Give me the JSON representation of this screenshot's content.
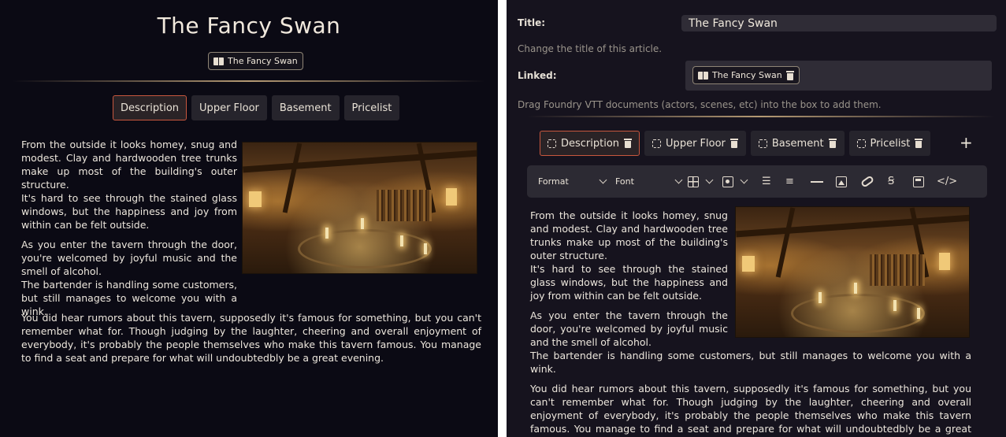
{
  "viewer": {
    "title": "The Fancy Swan",
    "linked_doc": "The Fancy Swan",
    "tabs": [
      {
        "label": "Description",
        "active": true
      },
      {
        "label": "Upper Floor",
        "active": false
      },
      {
        "label": "Basement",
        "active": false
      },
      {
        "label": "Pricelist",
        "active": false
      }
    ],
    "paragraphs": [
      "From the outside it looks homey, snug and modest. Clay and hardwooden tree trunks make up most of the building's outer structure.",
      "It's hard to see through the stained glass windows, but the happiness and joy from within can be felt outside.",
      "As you enter the tavern through the door, you're welcomed by joyful music and the smell of alcohol.",
      "The bartender is handling some customers, but still manages to welcome you with a wink.",
      "You did hear rumors about this tavern, supposedly it's famous for something, but you can't remember what for. Though judging by the laughter, cheering and overall enjoyment of everybody, it's probably the people themselves who make this tavern famous. You manage to find a seat and prepare for what will undoubtedbly be a great evening."
    ]
  },
  "editor": {
    "title_label": "Title:",
    "title_value": "The Fancy Swan",
    "title_hint": "Change the title of this article.",
    "linked_label": "Linked:",
    "linked_doc": "The Fancy Swan",
    "linked_hint": "Drag Foundry VTT documents (actors, scenes, etc) into the box to add them.",
    "tabs": [
      {
        "label": "Description",
        "active": true
      },
      {
        "label": "Upper Floor",
        "active": false
      },
      {
        "label": "Basement",
        "active": false
      },
      {
        "label": "Pricelist",
        "active": false
      }
    ],
    "add_tab_label": "+",
    "toolbar": {
      "format_label": "Format",
      "font_label": "Font"
    }
  },
  "colors": {
    "viewer_bg": "#0b0a14",
    "editor_bg": "#16131e",
    "active_tab_border": "#c8573e",
    "rule_gold": "#b59a74"
  }
}
